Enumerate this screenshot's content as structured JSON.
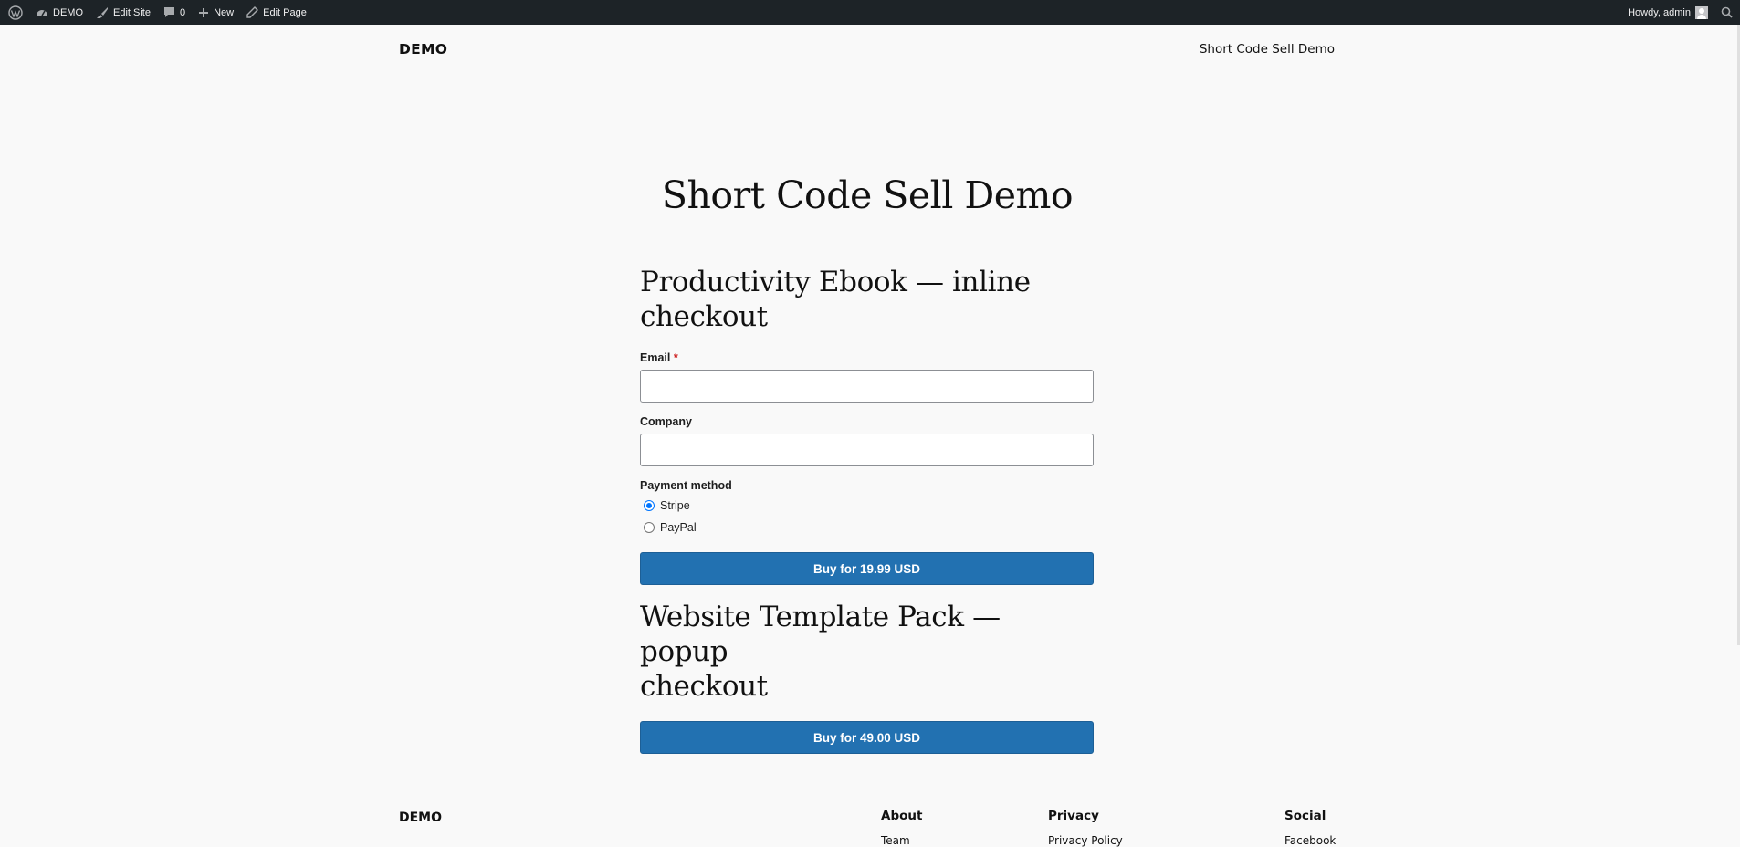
{
  "adminbar": {
    "site_name": "DEMO",
    "edit_site": "Edit Site",
    "comments_count": "0",
    "new": "New",
    "edit_page": "Edit Page",
    "howdy": "Howdy, admin"
  },
  "header": {
    "site_title": "DEMO",
    "nav_item": "Short Code Sell Demo"
  },
  "page": {
    "title": "Short Code Sell Demo"
  },
  "product1": {
    "heading_line1": "Productivity Ebook — inline",
    "heading_line2": "checkout",
    "email_label": "Email",
    "required_mark": "*",
    "company_label": "Company",
    "payment_label": "Payment method",
    "options": [
      "Stripe",
      "PayPal"
    ],
    "selected_option": "Stripe",
    "button_label": "Buy for 19.99 USD"
  },
  "product2": {
    "heading_line1": "Website Template Pack — popup",
    "heading_line2": "checkout",
    "button_label": "Buy for 49.00 USD"
  },
  "footer": {
    "site_title": "DEMO",
    "columns": [
      {
        "heading": "About",
        "link": "Team"
      },
      {
        "heading": "Privacy",
        "link": "Privacy Policy"
      },
      {
        "heading": "Social",
        "link": "Facebook"
      }
    ]
  },
  "colors": {
    "adminbar": "#1d2327",
    "button": "#2271b1",
    "background": "#f9f9f9",
    "required": "#cc1818"
  }
}
